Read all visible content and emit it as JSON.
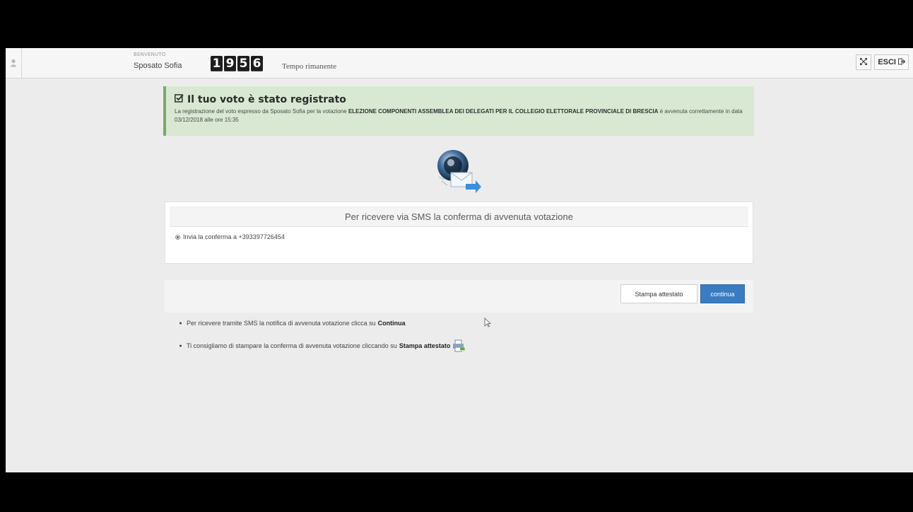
{
  "topbar": {
    "welcome_label": "BENVENUTO",
    "user_name": "Sposato Sofia",
    "timer_digits": [
      "1",
      "9",
      "5",
      "6"
    ],
    "timer_label": "Tempo rimanente",
    "exit_label": "ESCI"
  },
  "alert": {
    "title": "Il tuo voto è stato registrato",
    "text_prefix": "La registrazione del voto espresso da Sposato Sofia per la votazione ",
    "election_name": "ELEZIONE COMPONENTI ASSEMBLEA DEI DELEGATI PER IL COLLEGIO ELETTORALE PROVINCIALE DI BRESCIA",
    "text_suffix": " è avvenuta correttamente in data 03/12/2018 alle ore 15:35"
  },
  "sms": {
    "title": "Per ricevere via SMS la conferma di avvenuta votazione",
    "option_label": "Invia la conferma a +393397726454"
  },
  "actions": {
    "print_label": "Stampa attestato",
    "continue_label": "continua"
  },
  "instructions": {
    "item1_text": "Per ricevere tramite SMS la notifica di avvenuta votazione clicca su",
    "item1_bold": "Continua",
    "item2_text": "Ti consigliamo di stampare la conferma di avvenuta votazione cliccando su",
    "item2_bold": "Stampa attestato"
  },
  "colors": {
    "alert_bg": "#d8e8d2",
    "alert_border": "#7aa86b",
    "primary_button": "#3a7cc1"
  },
  "icons": [
    "user-icon",
    "expand-icon",
    "exit-icon",
    "check-icon",
    "vote-emblem-icon",
    "printer-icon",
    "cursor-icon"
  ]
}
